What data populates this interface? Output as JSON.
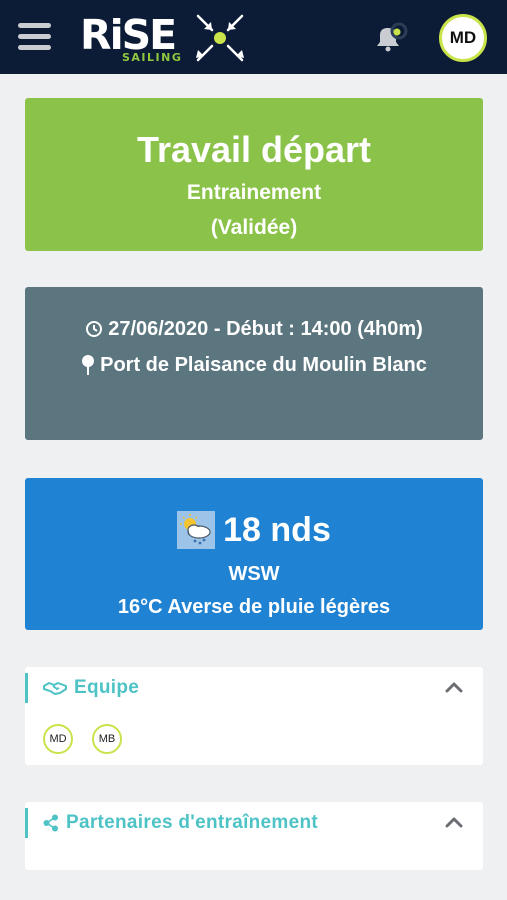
{
  "header": {
    "menu_icon": "hamburger-menu-icon",
    "logo_main": "RiSE",
    "logo_sub": "SAILING",
    "bell_icon": "bell-icon",
    "user_initials": "MD"
  },
  "session": {
    "title": "Travail départ",
    "type": "Entrainement",
    "status": "(Validée)",
    "color": "#8bc34a"
  },
  "info": {
    "date_line": "27/06/2020 - Début : 14:00 (4h0m)",
    "location": "Port de Plaisance du Moulin Blanc",
    "clock_icon": "clock-icon",
    "pin_icon": "map-pin-icon",
    "color": "#5c7680"
  },
  "weather": {
    "icon": "sun-cloud-rain-icon",
    "wind_speed": "18 nds",
    "wind_direction": "WSW",
    "description": "16°C Averse de pluie légères",
    "color": "#1f82d2"
  },
  "team": {
    "title": "Equipe",
    "icon": "handshake-icon",
    "members": [
      "MD",
      "MB"
    ]
  },
  "partners": {
    "title": "Partenaires d'entraînement",
    "icon": "share-icon"
  },
  "accent": "#4ec3c6"
}
